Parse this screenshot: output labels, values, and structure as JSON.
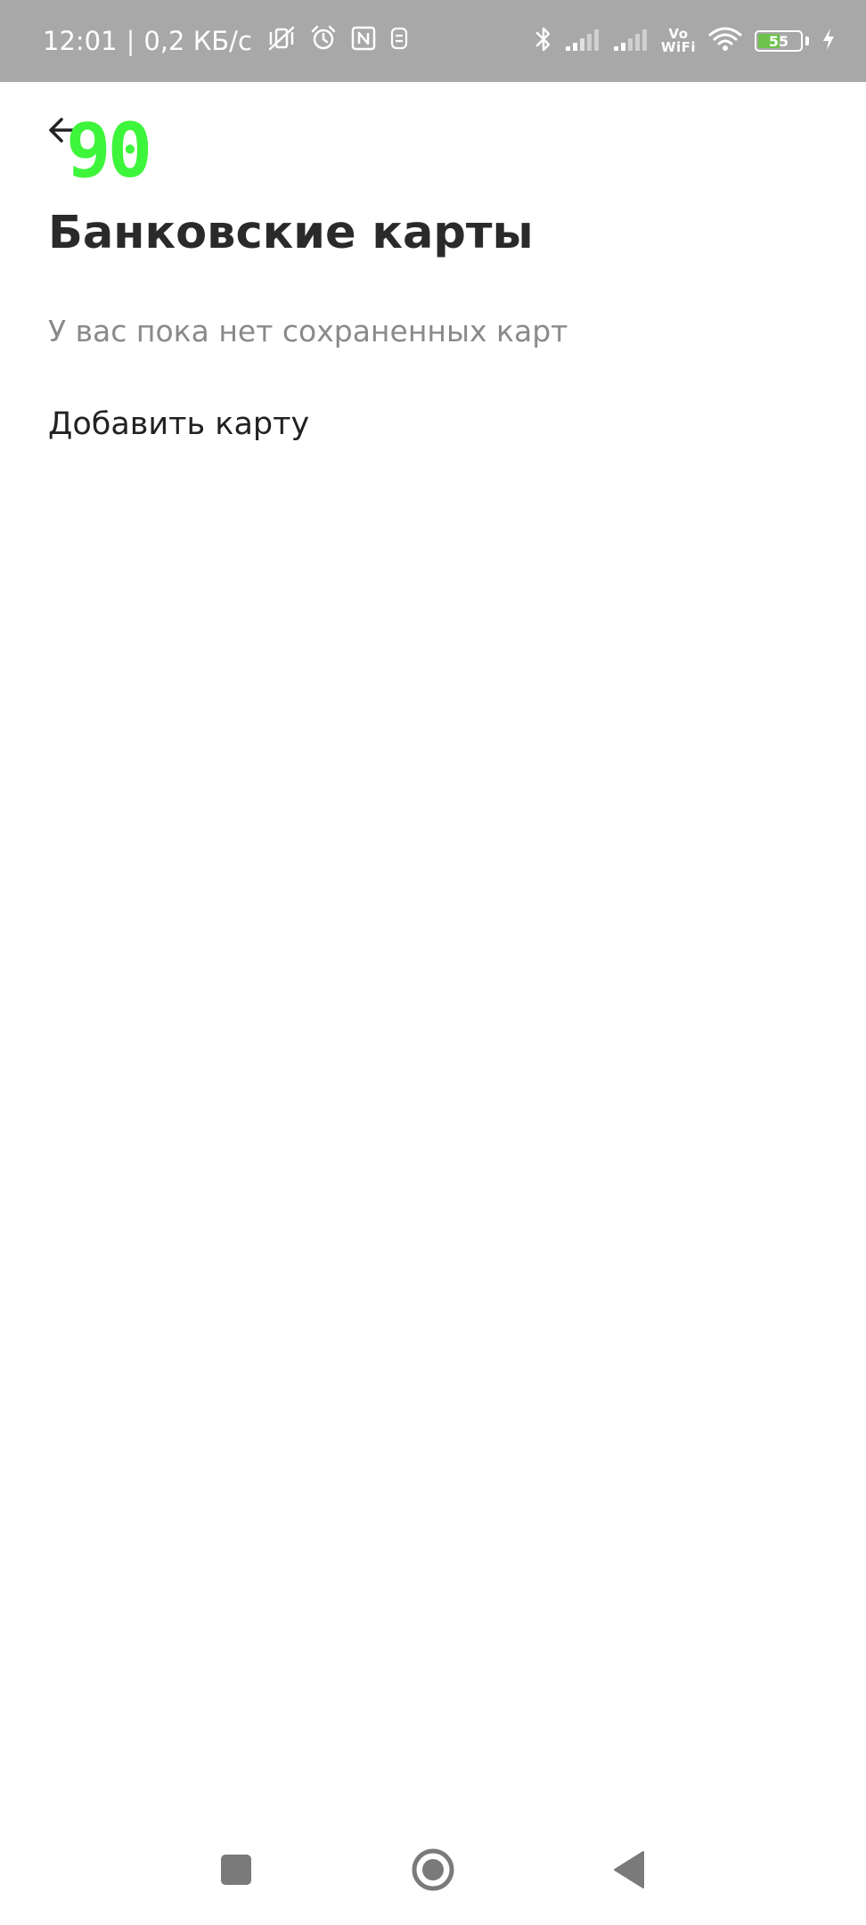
{
  "status_bar": {
    "time": "12:01",
    "separator": "|",
    "net_speed": "0,2 КБ/с",
    "icons_left": [
      "vibrate-off-icon",
      "alarm-icon",
      "nfc-icon",
      "screen-record-icon"
    ],
    "icons_right": [
      "bluetooth-icon",
      "signal-sim1-icon",
      "signal-sim2-icon",
      "vowifi-icon",
      "wifi-icon",
      "battery-icon",
      "charging-icon"
    ],
    "vowifi_top": "Vo",
    "vowifi_bottom": "WiFi",
    "battery_level": "55",
    "battery_fraction": 0.55,
    "battery_color": "#6cc24a"
  },
  "overlay": {
    "fps_counter": "90",
    "fps_color": "#3df53a"
  },
  "header": {
    "back_icon": "arrow-left-icon",
    "title": "Банковские карты"
  },
  "main": {
    "empty_message": "У вас пока нет сохраненных карт",
    "add_card_label": "Добавить карту"
  },
  "nav_bar": {
    "buttons": [
      "recents-icon",
      "home-icon",
      "back-triangle-icon"
    ]
  }
}
